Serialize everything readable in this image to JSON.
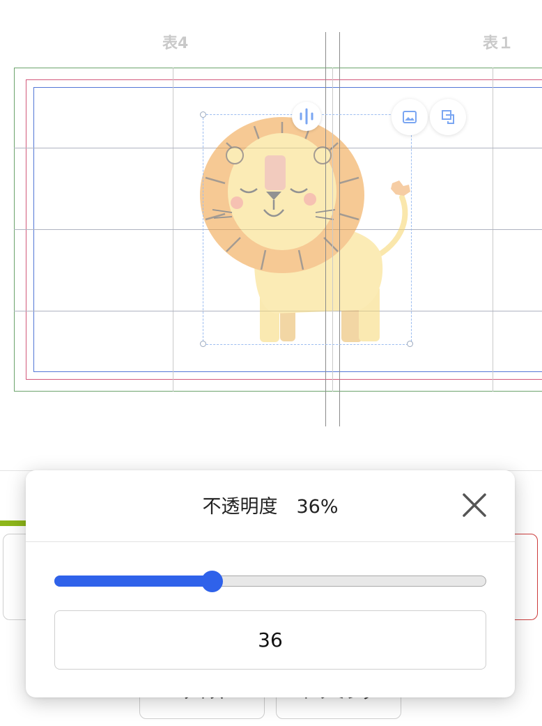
{
  "canvas": {
    "page_labels": {
      "left": "表4",
      "right": "表１"
    }
  },
  "background_panel": {
    "button_left_label": "サイズ",
    "button_right_label": "トリミング"
  },
  "opacity_popup": {
    "title": "不透明度　36%",
    "value": 36,
    "max": 100,
    "input_value": "36",
    "accent_color": "#2f62ea"
  },
  "icons": [
    "rotate-handle-icon",
    "image-icon",
    "duplicate-icon",
    "close-icon"
  ]
}
